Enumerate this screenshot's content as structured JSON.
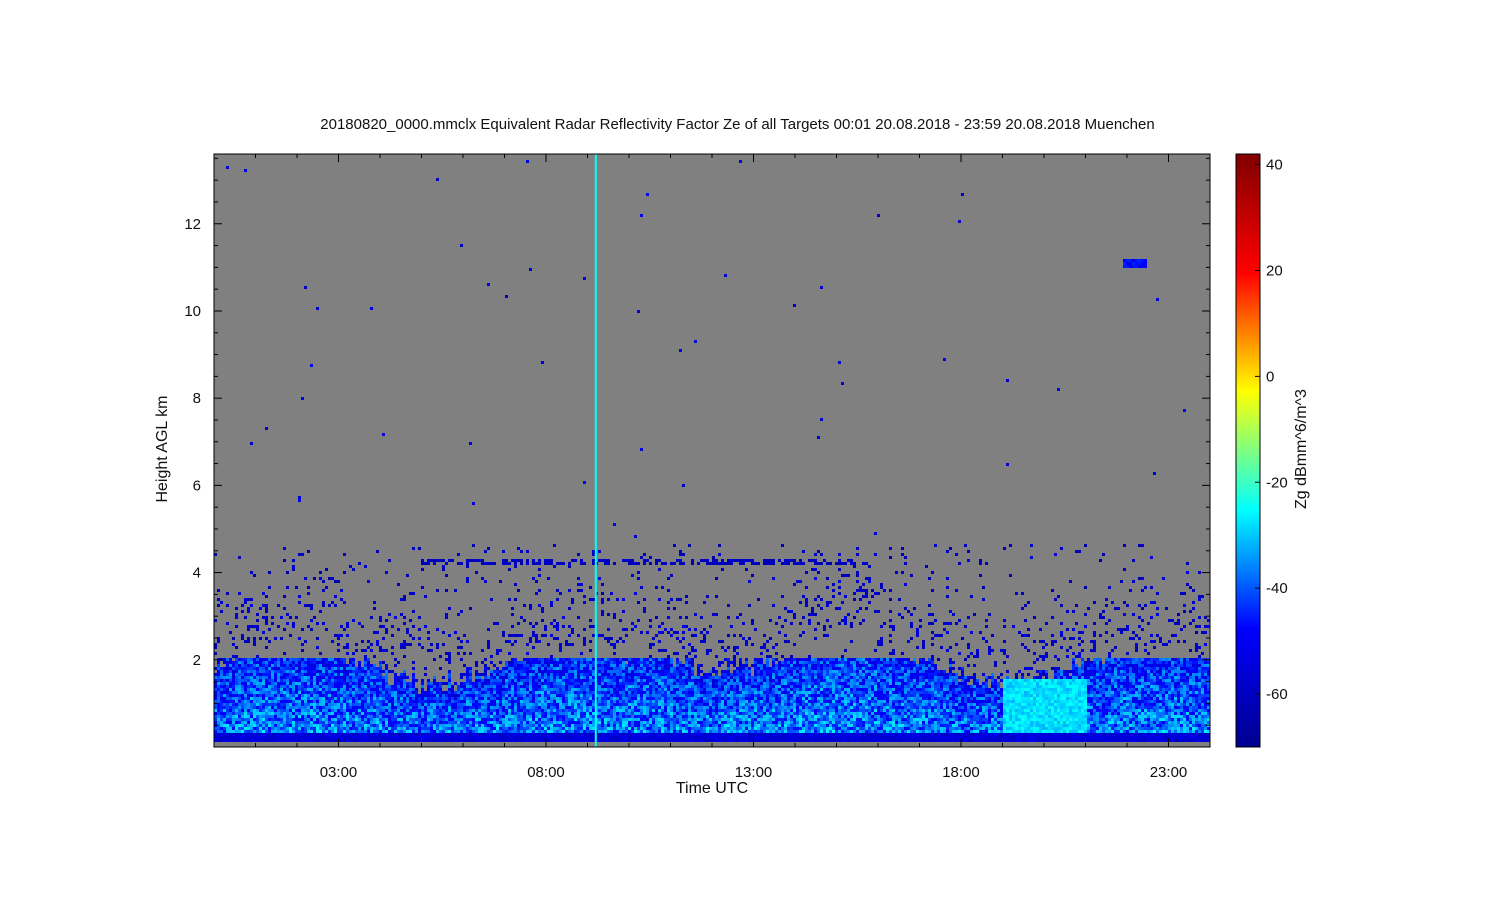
{
  "chart_data": {
    "type": "heatmap",
    "title": "20180820_0000.mmclx Equivalent Radar Reflectivity Factor Ze of all Targets   00:01 20.08.2018 - 23:59 20.08.2018 Muenchen",
    "xlabel": "Time UTC",
    "ylabel": "Height AGL km",
    "colorbar_label": "Zg dBmm^6/m^3",
    "xlim": [
      0.0,
      24.0
    ],
    "ylim": [
      0.0,
      13.6
    ],
    "x_ticks": [
      {
        "value": 3,
        "label": "03:00"
      },
      {
        "value": 8,
        "label": "08:00"
      },
      {
        "value": 13,
        "label": "13:00"
      },
      {
        "value": 18,
        "label": "18:00"
      },
      {
        "value": 23,
        "label": "23:00"
      }
    ],
    "y_ticks": [
      {
        "value": 2,
        "label": "2"
      },
      {
        "value": 4,
        "label": "4"
      },
      {
        "value": 6,
        "label": "6"
      },
      {
        "value": 8,
        "label": "8"
      },
      {
        "value": 10,
        "label": "10"
      },
      {
        "value": 12,
        "label": "12"
      }
    ],
    "colorbar": {
      "min": -70,
      "max": 42,
      "ticks": [
        {
          "value": 40,
          "label": "40"
        },
        {
          "value": 20,
          "label": "20"
        },
        {
          "value": 0,
          "label": "0"
        },
        {
          "value": -20,
          "label": "-20"
        },
        {
          "value": -40,
          "label": "-40"
        },
        {
          "value": -60,
          "label": "-60"
        }
      ],
      "colormap": "jet",
      "stops": [
        "#00008f",
        "#0000ff",
        "#00ffff",
        "#ffff00",
        "#ff0000",
        "#800000"
      ]
    },
    "background_color": "#808080",
    "grid": false,
    "features": [
      {
        "name": "boundary layer echo",
        "time_range": [
          0.0,
          24.0
        ],
        "height_range": [
          0.2,
          2.0
        ],
        "typical_dBZ": -35
      },
      {
        "name": "surface band",
        "time_range": [
          0.0,
          24.0
        ],
        "height_range": [
          0.1,
          0.25
        ],
        "typical_dBZ": -55
      },
      {
        "name": "weak layer",
        "time_range": [
          5.0,
          15.5
        ],
        "height_range": [
          4.15,
          4.3
        ],
        "typical_dBZ": -60
      },
      {
        "name": "vertical streak",
        "time": 9.2,
        "height_range": [
          0.0,
          13.6
        ],
        "typical_dBZ": -25
      },
      {
        "name": "enhanced echo",
        "time_range": [
          19.0,
          21.0
        ],
        "height_range": [
          0.3,
          1.5
        ],
        "typical_dBZ": -28
      },
      {
        "name": "high cloud fragment",
        "time_range": [
          21.9,
          22.5
        ],
        "height_range": [
          10.95,
          11.15
        ],
        "typical_dBZ": -48
      }
    ]
  }
}
